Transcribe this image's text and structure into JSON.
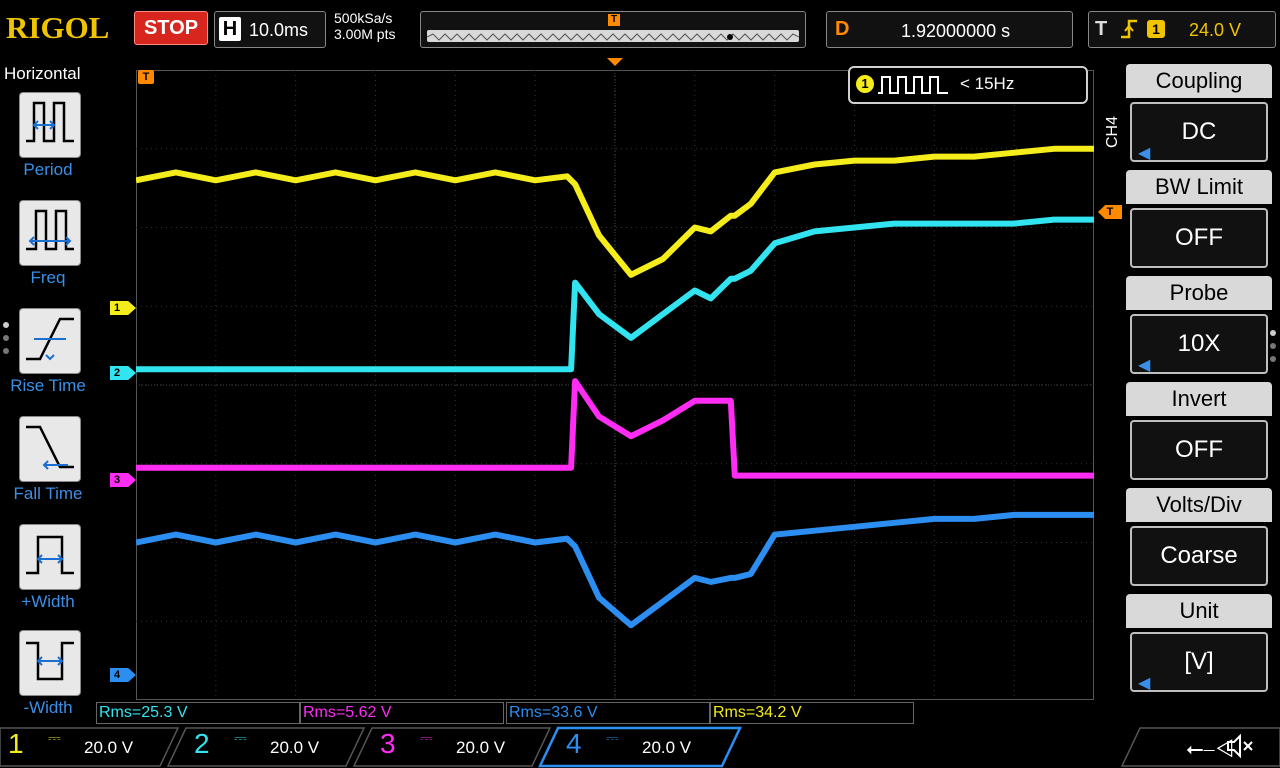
{
  "header": {
    "brand": "RIGOL",
    "run_state": "STOP",
    "timebase_label": "H",
    "timebase_value": "10.0ms",
    "sample_rate": "500kSa/s",
    "memory_depth": "3.00M pts",
    "trigger_marker": "T",
    "delay_label": "D",
    "delay_value": "1.92000000 s",
    "trigger_label": "T",
    "trigger_edge_icon": "rising-edge-icon",
    "trigger_source": "1",
    "trigger_level": "24.0 V"
  },
  "left_panel": {
    "title": "Horizontal",
    "items": [
      {
        "label": "Period",
        "icon": "period-icon"
      },
      {
        "label": "Freq",
        "icon": "frequency-icon"
      },
      {
        "label": "Rise Time",
        "icon": "rise-time-icon"
      },
      {
        "label": "Fall Time",
        "icon": "fall-time-icon"
      },
      {
        "label": "+Width",
        "icon": "positive-width-icon"
      },
      {
        "label": "-Width",
        "icon": "negative-width-icon"
      }
    ]
  },
  "frequency_counter": {
    "channel": "1",
    "text": "< 15Hz"
  },
  "channel_markers": [
    "1",
    "2",
    "3",
    "4"
  ],
  "right_panel": {
    "channel_tag": "CH4",
    "items": [
      {
        "title": "Coupling",
        "value": "DC",
        "arrow": true
      },
      {
        "title": "BW Limit",
        "value": "OFF",
        "arrow": false
      },
      {
        "title": "Probe",
        "value": "10X",
        "arrow": true
      },
      {
        "title": "Invert",
        "value": "OFF",
        "arrow": false
      },
      {
        "title": "Volts/Div",
        "value": "Coarse",
        "arrow": false
      },
      {
        "title": "Unit",
        "value": "[V]",
        "arrow": true
      }
    ]
  },
  "measurements": [
    {
      "text": "Rms=25.3 V",
      "color": "#32e4f0"
    },
    {
      "text": "Rms=5.62 V",
      "color": "#ff2cf4"
    },
    {
      "text": "Rms=33.6 V",
      "color": "#2b8ef0"
    },
    {
      "text": "Rms=34.2 V",
      "color": "#f5ec1b"
    }
  ],
  "channels": [
    {
      "num": "1",
      "coupling_icon": "dc-coupling-icon",
      "scale": "20.0 V",
      "color": "#f5ec1b"
    },
    {
      "num": "2",
      "coupling_icon": "dc-coupling-icon",
      "scale": "20.0 V",
      "color": "#32e4f0"
    },
    {
      "num": "3",
      "coupling_icon": "dc-coupling-icon",
      "scale": "20.0 V",
      "color": "#ff2cf4"
    },
    {
      "num": "4",
      "coupling_icon": "dc-coupling-icon",
      "scale": "20.0 V",
      "color": "#2b8ef0"
    }
  ],
  "colors": {
    "ch1": "#f5ec1b",
    "ch2": "#32e4f0",
    "ch3": "#ff2cf4",
    "ch4": "#2b8ef0",
    "trigger": "#ff8a00",
    "stop": "#d6261e",
    "accent": "#3a8fe8"
  },
  "chart_data": {
    "type": "line",
    "title": "",
    "xlabel": "",
    "ylabel": "",
    "grid": true,
    "x_divisions": 12,
    "y_divisions": 8,
    "xlim": [
      0,
      12
    ],
    "ylim": [
      0,
      8
    ],
    "series": [
      {
        "id": "ch1",
        "color": "#f5ec1b",
        "x": [
          0,
          0.5,
          1,
          1.5,
          2,
          2.5,
          3,
          3.5,
          4,
          4.5,
          5,
          5.4,
          5.5,
          5.8,
          6.2,
          6.6,
          7,
          7.2,
          7.45,
          7.5,
          7.7,
          8,
          8.5,
          9,
          9.5,
          10,
          10.5,
          11,
          11.5,
          12
        ],
        "y": [
          6.6,
          6.7,
          6.6,
          6.7,
          6.6,
          6.7,
          6.6,
          6.7,
          6.6,
          6.7,
          6.6,
          6.65,
          6.55,
          5.9,
          5.4,
          5.6,
          6.0,
          5.95,
          6.15,
          6.15,
          6.3,
          6.7,
          6.8,
          6.85,
          6.85,
          6.9,
          6.9,
          6.95,
          7.0,
          7.0
        ]
      },
      {
        "id": "ch2",
        "color": "#32e4f0",
        "x": [
          0,
          0.5,
          1,
          1.5,
          2,
          2.5,
          3,
          3.5,
          4,
          4.5,
          5,
          5.45,
          5.5,
          5.8,
          6.2,
          6.6,
          7,
          7.2,
          7.45,
          7.5,
          7.7,
          8,
          8.5,
          9,
          9.5,
          10,
          10.5,
          11,
          11.5,
          12
        ],
        "y": [
          4.2,
          4.2,
          4.2,
          4.2,
          4.2,
          4.2,
          4.2,
          4.2,
          4.2,
          4.2,
          4.2,
          4.2,
          5.3,
          4.9,
          4.6,
          4.9,
          5.2,
          5.1,
          5.35,
          5.35,
          5.45,
          5.8,
          5.95,
          6.0,
          6.05,
          6.05,
          6.05,
          6.05,
          6.1,
          6.1
        ]
      },
      {
        "id": "ch3",
        "color": "#ff2cf4",
        "x": [
          0,
          1,
          2,
          3,
          4,
          5,
          5.45,
          5.5,
          5.8,
          6.2,
          6.6,
          7,
          7.2,
          7.45,
          7.5,
          8,
          9,
          10,
          11,
          12
        ],
        "y": [
          2.95,
          2.95,
          2.95,
          2.95,
          2.95,
          2.95,
          2.95,
          4.05,
          3.6,
          3.35,
          3.55,
          3.8,
          3.8,
          3.8,
          2.85,
          2.85,
          2.85,
          2.85,
          2.85,
          2.85
        ]
      },
      {
        "id": "ch4",
        "color": "#2b8ef0",
        "x": [
          0,
          0.5,
          1,
          1.5,
          2,
          2.5,
          3,
          3.5,
          4,
          4.5,
          5,
          5.4,
          5.5,
          5.8,
          6.2,
          6.6,
          7,
          7.2,
          7.45,
          7.5,
          7.7,
          8,
          8.5,
          9,
          9.5,
          10,
          10.5,
          11,
          11.5,
          12
        ],
        "y": [
          2.0,
          2.1,
          2.0,
          2.1,
          2.0,
          2.1,
          2.0,
          2.1,
          2.0,
          2.1,
          2.0,
          2.05,
          1.95,
          1.3,
          0.95,
          1.25,
          1.55,
          1.5,
          1.55,
          1.55,
          1.6,
          2.1,
          2.15,
          2.2,
          2.25,
          2.3,
          2.3,
          2.35,
          2.35,
          2.35
        ]
      }
    ]
  }
}
